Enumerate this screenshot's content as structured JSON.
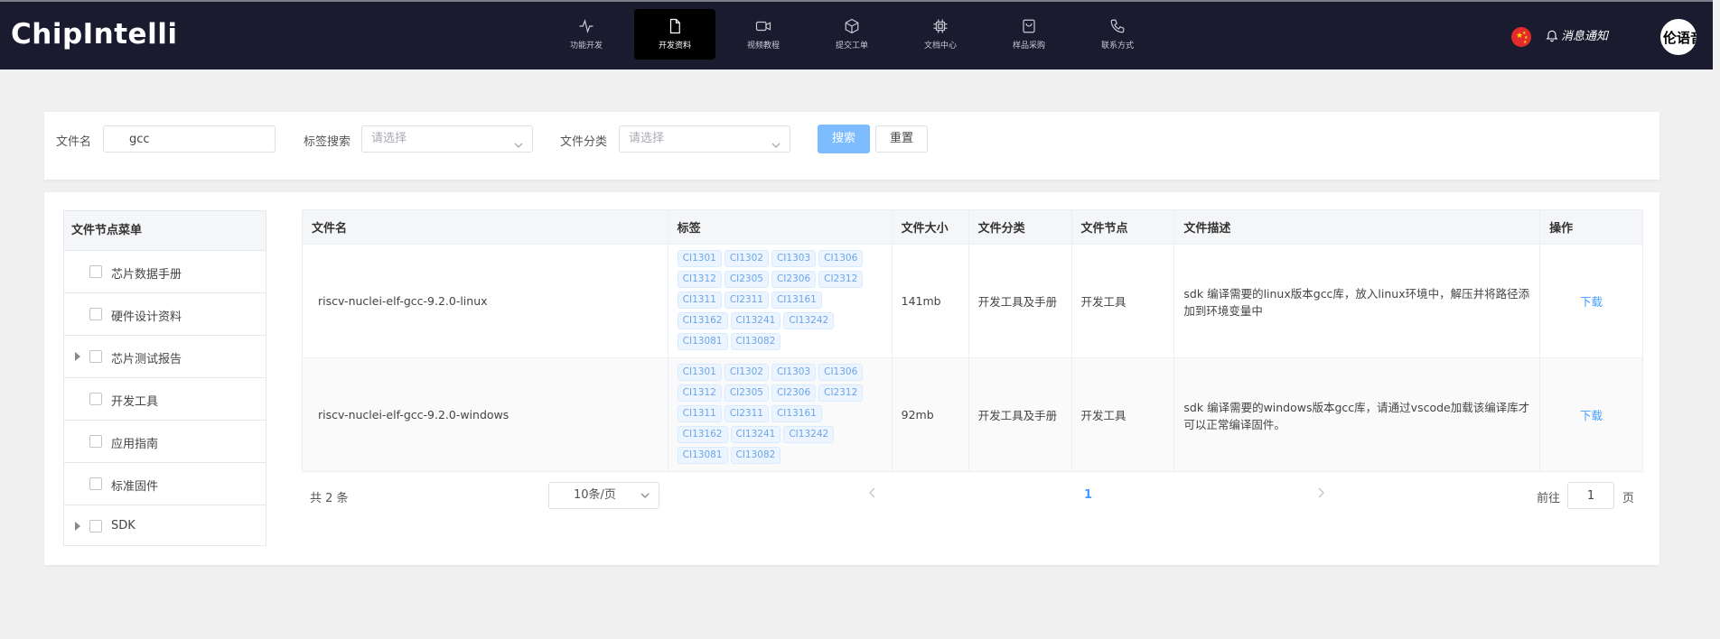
{
  "header": {
    "logo": "ChipIntelli",
    "nav": [
      {
        "label": "功能开发",
        "icon": "activity-icon",
        "active": false
      },
      {
        "label": "开发资料",
        "icon": "file-icon",
        "active": true
      },
      {
        "label": "视频教程",
        "icon": "video-icon",
        "active": false
      },
      {
        "label": "提交工单",
        "icon": "box-icon",
        "active": false
      },
      {
        "label": "文档中心",
        "icon": "chip-icon",
        "active": false
      },
      {
        "label": "样品采购",
        "icon": "shopping-bag-icon",
        "active": false
      },
      {
        "label": "联系方式",
        "icon": "phone-icon",
        "active": false
      }
    ],
    "notice": "消息通知",
    "avatar_text": "伦语音",
    "flag_icon": "china-flag-icon"
  },
  "search": {
    "file_name_label": "文件名",
    "file_name_value": "gcc",
    "tag_label": "标签搜索",
    "tag_placeholder": "请选择",
    "category_label": "文件分类",
    "category_placeholder": "请选择",
    "search_button": "搜索",
    "reset_button": "重置"
  },
  "tree": {
    "title": "文件节点菜单",
    "items": [
      {
        "label": "芯片数据手册",
        "expandable": false
      },
      {
        "label": "硬件设计资料",
        "expandable": false
      },
      {
        "label": "芯片测试报告",
        "expandable": true
      },
      {
        "label": "开发工具",
        "expandable": false
      },
      {
        "label": "应用指南",
        "expandable": false
      },
      {
        "label": "标准固件",
        "expandable": false
      },
      {
        "label": "SDK",
        "expandable": true
      }
    ]
  },
  "table": {
    "columns": [
      "文件名",
      "标签",
      "文件大小",
      "文件分类",
      "文件节点",
      "文件描述",
      "操作"
    ],
    "rows": [
      {
        "name": "riscv-nuclei-elf-gcc-9.2.0-linux",
        "tags": [
          "CI1301",
          "CI1302",
          "CI1303",
          "CI1306",
          "CI1312",
          "CI2305",
          "CI2306",
          "CI2312",
          "CI1311",
          "CI2311",
          "CI13161",
          "CI13162",
          "CI13241",
          "CI13242",
          "CI13081",
          "CI13082"
        ],
        "size": "141mb",
        "category": "开发工具及手册",
        "node": "开发工具",
        "description": "sdk 编译需要的linux版本gcc库，放入linux环境中，解压并将路径添加到环境变量中",
        "action": "下载"
      },
      {
        "name": "riscv-nuclei-elf-gcc-9.2.0-windows",
        "tags": [
          "CI1301",
          "CI1302",
          "CI1303",
          "CI1306",
          "CI1312",
          "CI2305",
          "CI2306",
          "CI2312",
          "CI1311",
          "CI2311",
          "CI13161",
          "CI13162",
          "CI13241",
          "CI13242",
          "CI13081",
          "CI13082"
        ],
        "size": "92mb",
        "category": "开发工具及手册",
        "node": "开发工具",
        "description": "sdk 编译需要的windows版本gcc库，请通过vscode加载该编译库才可以正常编译固件。",
        "action": "下载"
      }
    ]
  },
  "pagination": {
    "total": "共 2 条",
    "page_size": "10条/页",
    "current": "1",
    "goto_label": "前往",
    "goto_value": "1",
    "page_suffix": "页"
  },
  "colors": {
    "nav_bg": "#1a1b2e",
    "primary": "#409eff",
    "search_btn": "#7dbcff"
  }
}
